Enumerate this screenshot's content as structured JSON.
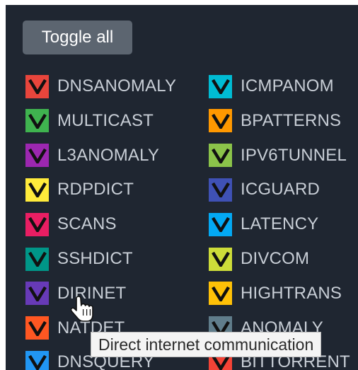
{
  "toolbar": {
    "toggle_all_label": "Toggle all"
  },
  "legend": {
    "col1": [
      {
        "key": "dnsanomaly",
        "label": "DNSANOMALY",
        "color": "#e8453c",
        "checked": true
      },
      {
        "key": "multicast",
        "label": "MULTICAST",
        "color": "#3fb34f",
        "checked": true
      },
      {
        "key": "l3anomaly",
        "label": "L3ANOMALY",
        "color": "#9c27b0",
        "checked": true
      },
      {
        "key": "rdpdict",
        "label": "RDPDICT",
        "color": "#ffeb3b",
        "checked": true
      },
      {
        "key": "scans",
        "label": "SCANS",
        "color": "#e91e63",
        "checked": true
      },
      {
        "key": "sshdict",
        "label": "SSHDICT",
        "color": "#009688",
        "checked": true
      },
      {
        "key": "dirinet",
        "label": "DIRINET",
        "color": "#673ab7",
        "checked": true
      },
      {
        "key": "natdet",
        "label": "NATDET",
        "color": "#ff5722",
        "checked": true
      },
      {
        "key": "dnsquery",
        "label": "DNSQUERY",
        "color": "#2196f3",
        "checked": true
      }
    ],
    "col2": [
      {
        "key": "icmpanom",
        "label": "ICMPANOM",
        "color": "#00bcd4",
        "checked": true
      },
      {
        "key": "bpatterns",
        "label": "BPATTERNS",
        "color": "#ff9800",
        "checked": true
      },
      {
        "key": "ipv6tunnel",
        "label": "IPV6TUNNEL",
        "color": "#8bc34a",
        "checked": true
      },
      {
        "key": "icguard",
        "label": "ICGUARD",
        "color": "#3f51b5",
        "checked": true
      },
      {
        "key": "latency",
        "label": "LATENCY",
        "color": "#03a9f4",
        "checked": true
      },
      {
        "key": "divcom",
        "label": "DIVCOM",
        "color": "#cddc39",
        "checked": true
      },
      {
        "key": "hightrans",
        "label": "HIGHTRANS",
        "color": "#ffc107",
        "checked": true
      },
      {
        "key": "anomaly",
        "label": "ANOMALY",
        "color": "#607d8b",
        "checked": true
      },
      {
        "key": "bittorrent",
        "label": "BITTORRENT",
        "color": "#f44336",
        "checked": true
      }
    ]
  },
  "tooltip": {
    "text": "Direct internet communication"
  }
}
